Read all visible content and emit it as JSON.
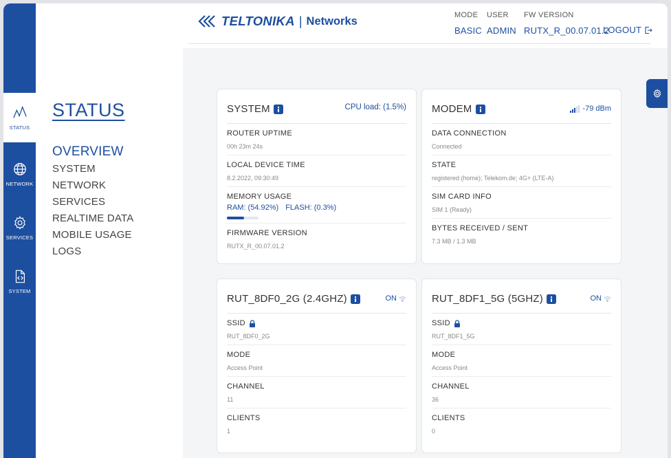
{
  "rail": {
    "items": [
      {
        "label": "STATUS",
        "icon": "status-wave-icon",
        "active": true
      },
      {
        "label": "NETWORK",
        "icon": "globe-icon"
      },
      {
        "label": "SERVICES",
        "icon": "gear-icon"
      },
      {
        "label": "SYSTEM",
        "icon": "file-code-icon"
      }
    ]
  },
  "nav": {
    "title": "STATUS",
    "links": [
      "OVERVIEW",
      "SYSTEM",
      "NETWORK",
      "SERVICES",
      "REALTIME DATA",
      "MOBILE USAGE",
      "LOGS"
    ]
  },
  "header": {
    "brand": "TELTONIKA",
    "separator": "|",
    "networks": "Networks",
    "mode_label": "MODE",
    "mode_value": "BASIC",
    "user_label": "USER",
    "user_value": "ADMIN",
    "fw_label": "FW VERSION",
    "fw_value": "RUTX_R_00.07.01.2",
    "logout": "LOGOUT"
  },
  "cards": {
    "system": {
      "title": "SYSTEM",
      "cpu_load": "CPU load: (1.5%)",
      "uptime_label": "ROUTER UPTIME",
      "uptime_value": "00h 23m 24s",
      "time_label": "LOCAL DEVICE TIME",
      "time_value": "8.2.2022, 09:30:49",
      "memory_label": "MEMORY USAGE",
      "ram": "RAM: (54.92%)",
      "flash": "FLASH: (0.3%)",
      "ram_fraction": 0.5492,
      "fw_label": "FIRMWARE VERSION",
      "fw_value": "RUTX_R_00.07.01.2"
    },
    "modem": {
      "title": "MODEM",
      "signal": "-79 dBm",
      "conn_label": "DATA CONNECTION",
      "conn_value": "Connected",
      "state_label": "STATE",
      "state_value": "registered (home); Telekom.de; 4G+ (LTE-A)",
      "sim_label": "SIM CARD INFO",
      "sim_value": "SIM 1 (Ready)",
      "bytes_label": "BYTES RECEIVED / SENT",
      "bytes_value": "7.3 MB / 1.3 MB"
    },
    "wifi24": {
      "title": "RUT_8DF0_2G (2.4GHZ)",
      "status": "ON",
      "ssid_label": "SSID",
      "ssid_value": "RUT_8DF0_2G",
      "mode_label": "MODE",
      "mode_value": "Access Point",
      "channel_label": "CHANNEL",
      "channel_value": "11",
      "clients_label": "CLIENTS",
      "clients_value": "1"
    },
    "wifi5": {
      "title": "RUT_8DF1_5G (5GHZ)",
      "status": "ON",
      "ssid_label": "SSID",
      "ssid_value": "RUT_8DF1_5G",
      "mode_label": "MODE",
      "mode_value": "Access Point",
      "channel_label": "CHANNEL",
      "channel_value": "36",
      "clients_label": "CLIENTS",
      "clients_value": "0"
    }
  },
  "colors": {
    "accent": "#1d4fa0",
    "background": "#f4f5f7"
  }
}
